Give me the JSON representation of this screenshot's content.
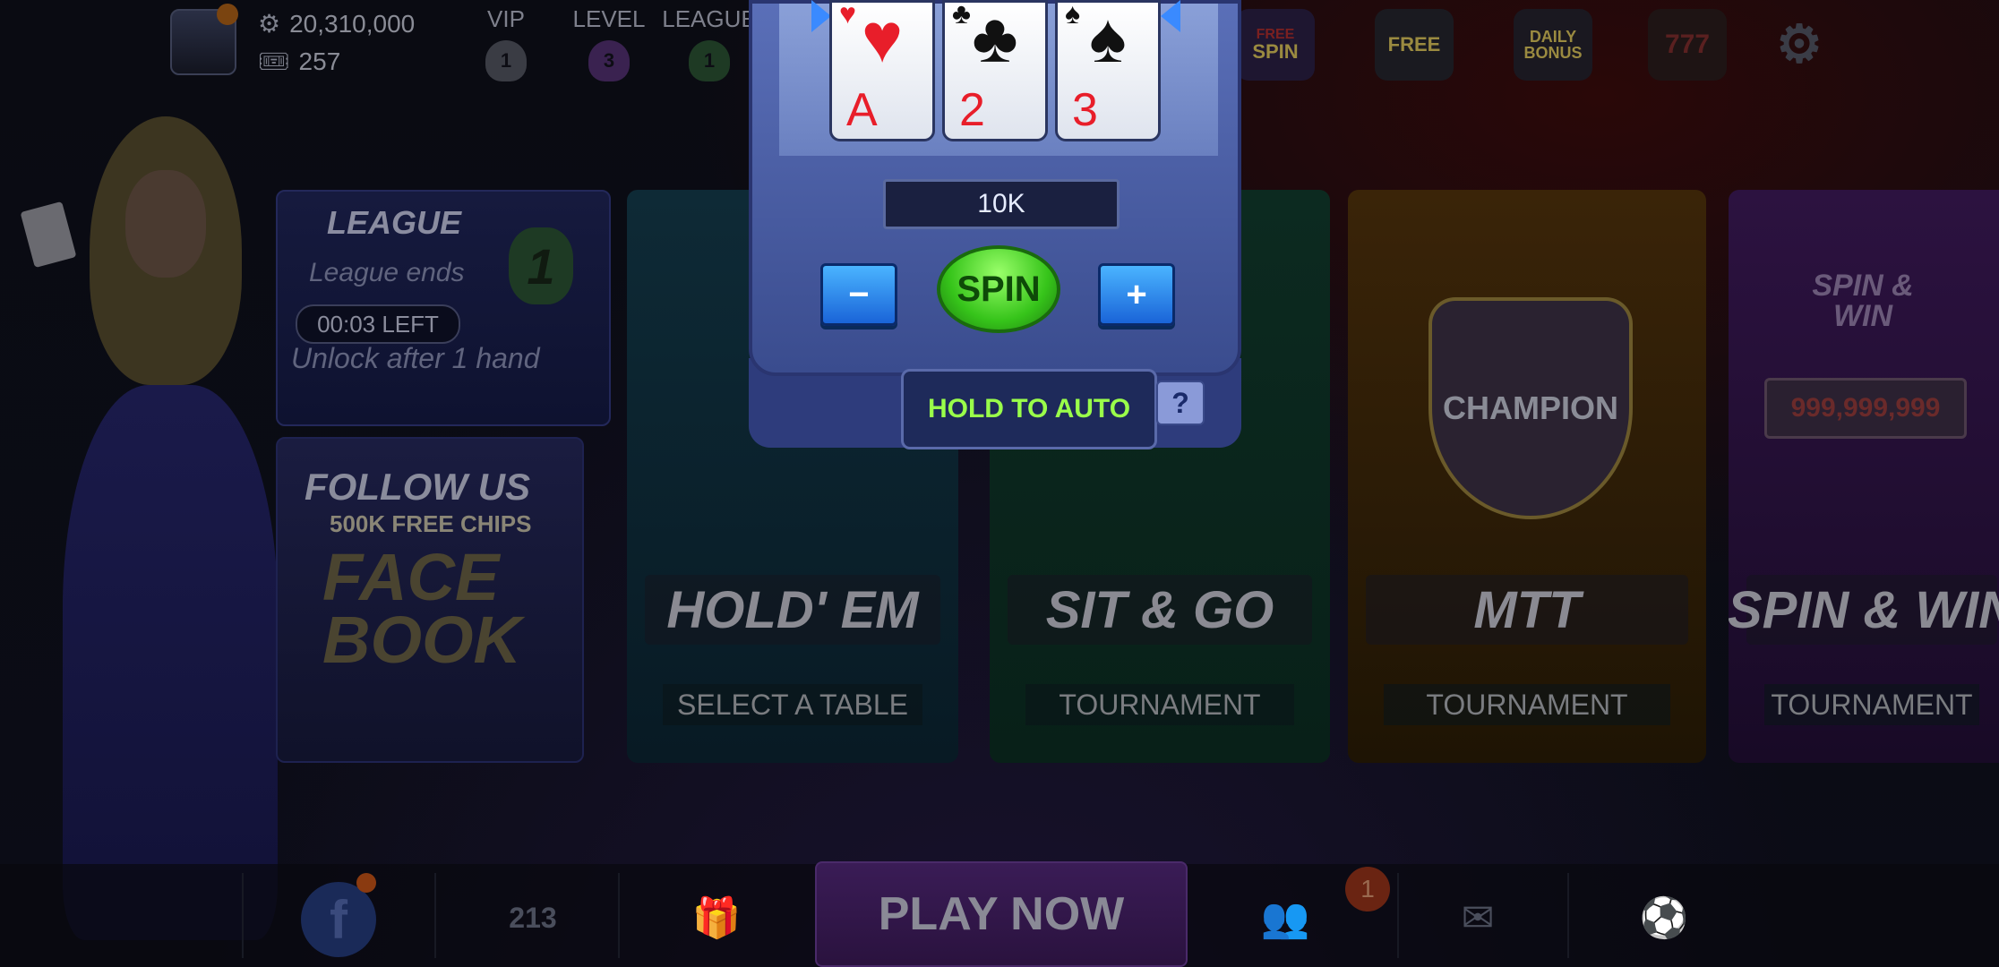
{
  "player": {
    "chips": "20,310,000",
    "tickets": "257"
  },
  "ranks": {
    "vip_label": "VIP",
    "vip_value": "1",
    "level_label": "LEVEL",
    "level_value": "3",
    "league_label": "LEAGUE",
    "league_value": "1"
  },
  "top_icons": {
    "free_spin": "SPIN",
    "free_spin_tag": "FREE",
    "free_tag": "FREE",
    "daily_bonus": "DAILY BONUS"
  },
  "league_panel": {
    "title": "LEAGUE",
    "subtitle": "League ends",
    "timer": "00:03 LEFT",
    "unlock": "Unlock after 1 hand",
    "badge": "1"
  },
  "follow_panel": {
    "title": "FOLLOW US",
    "subtitle": "500K FREE CHIPS",
    "brand": "FACE BOOK"
  },
  "game_cards": {
    "holdem_title": "HOLD' EM",
    "holdem_sub": "SELECT A TABLE",
    "sitgo_title": "SIT & GO",
    "sitgo_sub": "TOURNAMENT",
    "mtt_title": "MTT",
    "mtt_sub": "TOURNAMENT",
    "mtt_emblem": "CHAMPION",
    "spin_title": "SPIN & WIN",
    "spin_sub": "TOURNAMENT",
    "spin_logo": "SPIN & WIN",
    "spin_jackpot": "999,999,999"
  },
  "slot_machine": {
    "reels": [
      {
        "rank": "A",
        "suit": "♥"
      },
      {
        "rank": "2",
        "suit": "♣"
      },
      {
        "rank": "3",
        "suit": "♠"
      }
    ],
    "bet": "10K",
    "minus_label": "−",
    "plus_label": "+",
    "spin_label": "SPIN",
    "auto_label": "HOLD TO AUTO",
    "help_label": "?"
  },
  "bottom_bar": {
    "play_now": "PLAY NOW",
    "friends_badge": "1",
    "facebook_label": "f",
    "leaderboard_label": "213"
  },
  "colors": {
    "accent_green": "#9aff4a",
    "slot_blue": "#3a4c8e",
    "heart_red": "#e81e2a"
  }
}
